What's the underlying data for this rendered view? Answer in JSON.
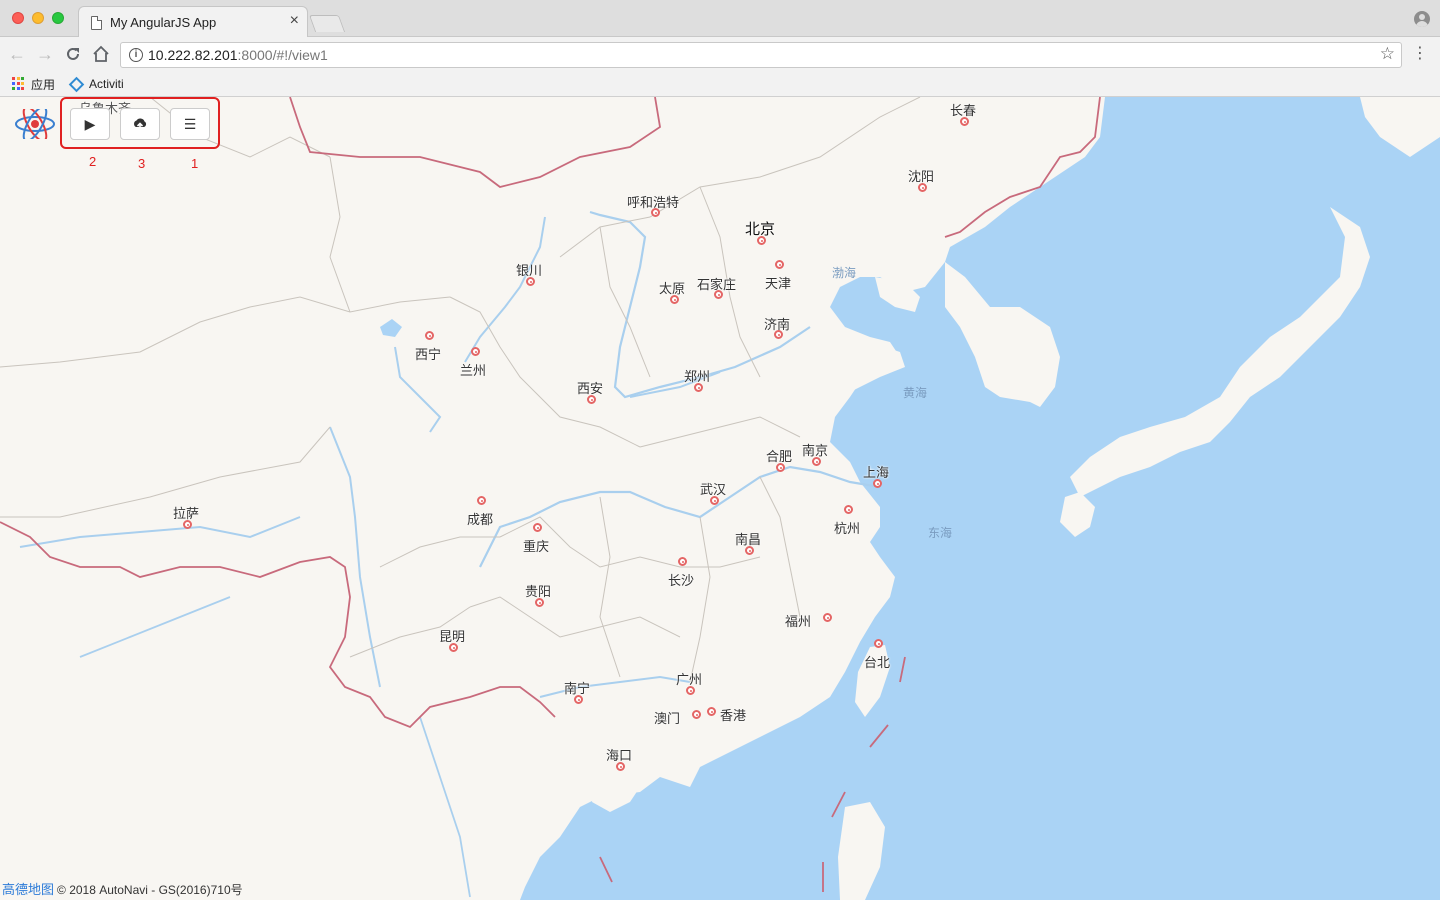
{
  "browser": {
    "tab_title": "My AngularJS App",
    "tab_close": "×",
    "url_host": "10.222.82.201",
    "url_rest": ":8000/#!/view1",
    "bookmarks": [
      {
        "label": "应用",
        "icon": "apps-grid-icon"
      },
      {
        "label": "Activiti",
        "icon": "activiti-diamond-icon"
      }
    ]
  },
  "map_controls": {
    "play_icon": "▶",
    "upload_icon": "cloud-upload-icon",
    "menu_icon": "☰",
    "annotations": {
      "play": "2",
      "upload": "3",
      "menu": "1"
    }
  },
  "map": {
    "cities": [
      {
        "name": "长春"
      },
      {
        "name": "沈阳"
      },
      {
        "name": "呼和浩特"
      },
      {
        "name": "北京",
        "capital": true
      },
      {
        "name": "天津"
      },
      {
        "name": "石家庄"
      },
      {
        "name": "太原"
      },
      {
        "name": "银川"
      },
      {
        "name": "济南"
      },
      {
        "name": "西宁"
      },
      {
        "name": "兰州"
      },
      {
        "name": "郑州"
      },
      {
        "name": "西安"
      },
      {
        "name": "合肥"
      },
      {
        "name": "南京"
      },
      {
        "name": "上海"
      },
      {
        "name": "武汉"
      },
      {
        "name": "拉萨"
      },
      {
        "name": "成都"
      },
      {
        "name": "重庆"
      },
      {
        "name": "杭州"
      },
      {
        "name": "南昌"
      },
      {
        "name": "长沙"
      },
      {
        "name": "贵阳"
      },
      {
        "name": "福州"
      },
      {
        "name": "台北"
      },
      {
        "name": "昆明"
      },
      {
        "name": "广州"
      },
      {
        "name": "南宁"
      },
      {
        "name": "澳门"
      },
      {
        "name": "香港"
      },
      {
        "name": "海口"
      }
    ],
    "seas": [
      "渤海",
      "黄海",
      "东海"
    ],
    "partial_label": "乌鲁木齐",
    "attribution": {
      "brand": "高德地图",
      "text": "© 2018 AutoNavi - GS(2016)710号"
    }
  },
  "colors": {
    "land": "#f8f6f2",
    "water": "#aad3f5",
    "river": "#a9cfee",
    "border": "#c86a7c",
    "highlight": "#e02020"
  }
}
